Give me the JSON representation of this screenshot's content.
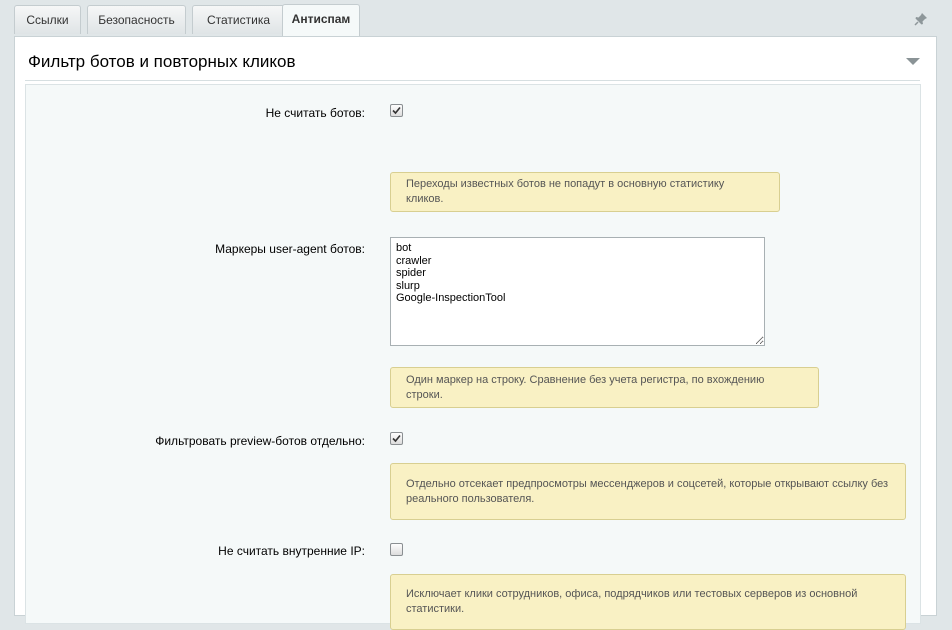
{
  "tabs": [
    {
      "label": "Ссылки",
      "active": false
    },
    {
      "label": "Безопасность",
      "active": false
    },
    {
      "label": "Статистика",
      "active": false
    },
    {
      "label": "Антиспам",
      "active": true
    }
  ],
  "section": {
    "title": "Фильтр ботов и повторных кликов"
  },
  "fields": {
    "exclude_bots": {
      "label": "Не считать ботов:",
      "checked": true,
      "hint": "Переходы известных ботов не попадут в основную статистику кликов."
    },
    "bot_markers": {
      "label": "Маркеры user-agent ботов:",
      "value": "bot\ncrawler\nspider\nslurp\nGoogle-InspectionTool",
      "hint": "Один маркер на строку. Сравнение без учета регистра, по вхождению строки."
    },
    "filter_preview": {
      "label": "Фильтровать preview-ботов отдельно:",
      "checked": true,
      "hint": "Отдельно отсекает предпросмотры мессенджеров и соцсетей, которые открывают ссылку без реального пользователя."
    },
    "exclude_internal_ip": {
      "label": "Не считать внутренние IP:",
      "checked": false,
      "hint": "Исключает клики сотрудников, офиса, подрядчиков или тестовых серверов из основной статистики."
    }
  },
  "icons": {
    "pin": "pin-icon",
    "collapse": "chevron-down-icon",
    "check": "check-icon"
  },
  "colors": {
    "hint_bg": "#f9f1c4",
    "hint_border": "#d8cf91",
    "page_bg": "#e0e6e8"
  }
}
